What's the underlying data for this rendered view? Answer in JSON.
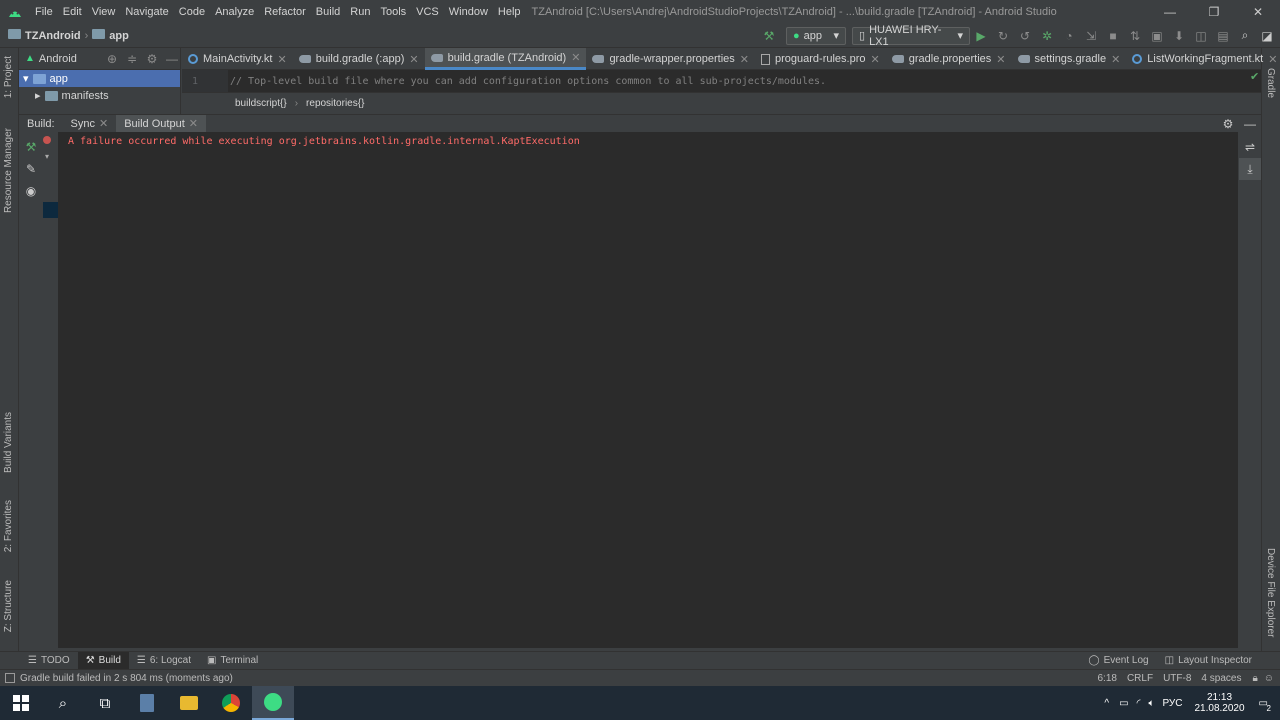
{
  "window": {
    "title": "TZAndroid [C:\\Users\\Andrej\\AndroidStudioProjects\\TZAndroid] - ...\\build.gradle [TZAndroid] - Android Studio",
    "controls": {
      "minimize": "—",
      "maximize": "❐",
      "close": "✕"
    }
  },
  "menu": [
    "File",
    "Edit",
    "View",
    "Navigate",
    "Code",
    "Analyze",
    "Refactor",
    "Build",
    "Run",
    "Tools",
    "VCS",
    "Window",
    "Help"
  ],
  "navbar": {
    "project": "TZAndroid",
    "module": "app",
    "run_config": "app",
    "device": "HUAWEI HRY-LX1"
  },
  "left_stripe": {
    "project": "1: Project",
    "resource_manager": "Resource Manager",
    "build_variants": "Build Variants",
    "favorites": "2: Favorites",
    "structure": "Z: Structure"
  },
  "right_stripe": {
    "gradle": "Gradle",
    "device_file_explorer": "Device File Explorer"
  },
  "project_panel": {
    "view": "Android",
    "tree": [
      {
        "label": "app",
        "selected": true
      },
      {
        "label": "manifests",
        "selected": false
      }
    ]
  },
  "tabs": [
    {
      "label": "MainActivity.kt",
      "icon": "kotlin-icon",
      "active": false
    },
    {
      "label": "build.gradle (:app)",
      "icon": "gradle-icon",
      "active": false
    },
    {
      "label": "build.gradle (TZAndroid)",
      "icon": "gradle-icon",
      "active": true
    },
    {
      "label": "gradle-wrapper.properties",
      "icon": "file-icon",
      "active": false
    },
    {
      "label": "proguard-rules.pro",
      "icon": "file-icon",
      "active": false
    },
    {
      "label": "gradle.properties",
      "icon": "gradle-icon",
      "active": false
    },
    {
      "label": "settings.gradle",
      "icon": "gradle-icon",
      "active": false
    },
    {
      "label": "ListWorkingFragment.kt",
      "icon": "kotlin-icon",
      "active": false
    }
  ],
  "editor": {
    "line_number": "1",
    "code_line": "// Top-level build file where you can add configuration options common to all sub-projects/modules.",
    "breadcrumbs": [
      "buildscript{}",
      "repositories{}"
    ]
  },
  "build_window": {
    "label": "Build:",
    "tabs": [
      "Sync",
      "Build Output"
    ],
    "active_tab": "Build Output",
    "error": "A failure occurred while executing org.jetbrains.kotlin.gradle.internal.KaptExecution"
  },
  "tool_strip": {
    "todo": "TODO",
    "build": "Build",
    "logcat": "6: Logcat",
    "terminal": "Terminal",
    "event_log": "Event Log",
    "layout_inspector": "Layout Inspector"
  },
  "status": {
    "message": "Gradle build failed in 2 s 804 ms (moments ago)",
    "position": "6:18",
    "line_sep": "CRLF",
    "encoding": "UTF-8",
    "indent": "4 spaces"
  },
  "taskbar": {
    "language": "РУС",
    "time": "21:13",
    "date": "21.08.2020",
    "notifications": "2"
  },
  "colors": {
    "error": "#ff6b68",
    "selection": "#4b6eaf",
    "run_green": "#59a869",
    "accent": "#4a88c7"
  }
}
